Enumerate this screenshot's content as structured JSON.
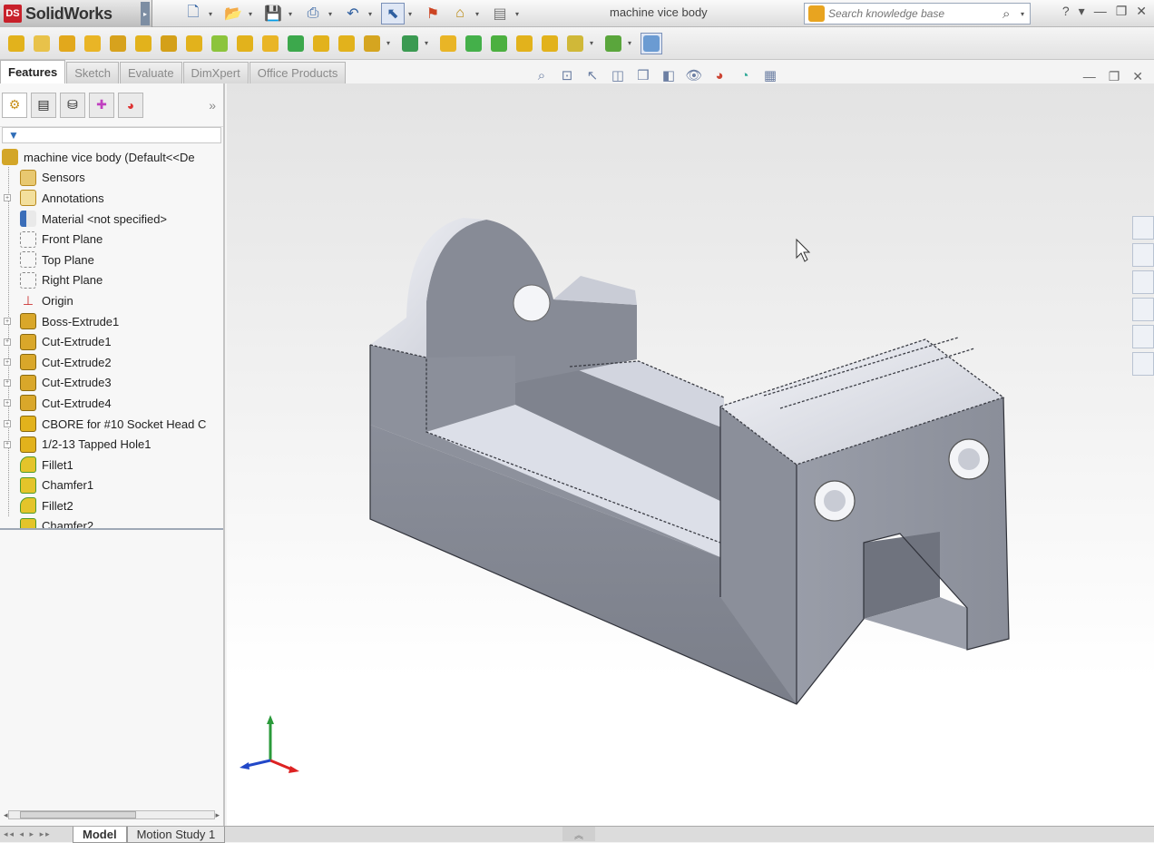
{
  "app": {
    "name": "SolidWorks",
    "logo_text": "DS"
  },
  "document_title": "machine vice body",
  "search": {
    "placeholder": "Search knowledge base"
  },
  "window_controls": [
    "?",
    "▾",
    "—",
    "❐",
    "✕"
  ],
  "command_tabs": [
    {
      "label": "Features",
      "active": true
    },
    {
      "label": "Sketch",
      "active": false
    },
    {
      "label": "Evaluate",
      "active": false
    },
    {
      "label": "DimXpert",
      "active": false
    },
    {
      "label": "Office Products",
      "active": false
    }
  ],
  "feature_tree": {
    "root": "machine vice body  (Default<<De",
    "items": [
      {
        "label": "Sensors",
        "icon": "sensor-icon"
      },
      {
        "label": "Annotations",
        "icon": "annotation-icon"
      },
      {
        "label": "Material <not specified>",
        "icon": "material-icon"
      },
      {
        "label": "Front Plane",
        "icon": "plane-icon"
      },
      {
        "label": "Top Plane",
        "icon": "plane-icon"
      },
      {
        "label": "Right Plane",
        "icon": "plane-icon"
      },
      {
        "label": "Origin",
        "icon": "origin-icon"
      },
      {
        "label": "Boss-Extrude1",
        "icon": "extrude-icon"
      },
      {
        "label": "Cut-Extrude1",
        "icon": "cut-icon"
      },
      {
        "label": "Cut-Extrude2",
        "icon": "cut-icon"
      },
      {
        "label": "Cut-Extrude3",
        "icon": "cut-icon"
      },
      {
        "label": "Cut-Extrude4",
        "icon": "cut-icon"
      },
      {
        "label": "CBORE for #10 Socket Head C",
        "icon": "hole-icon"
      },
      {
        "label": "1/2-13 Tapped Hole1",
        "icon": "hole-icon"
      },
      {
        "label": "Fillet1",
        "icon": "fillet-icon"
      },
      {
        "label": "Chamfer1",
        "icon": "chamfer-icon"
      },
      {
        "label": "Fillet2",
        "icon": "fillet-icon"
      },
      {
        "label": "Chamfer2",
        "icon": "chamfer-icon"
      }
    ]
  },
  "bottom_tabs": [
    {
      "label": "Model",
      "active": true
    },
    {
      "label": "Motion Study 1",
      "active": false
    }
  ],
  "colors": {
    "accent": "#2f5fa0",
    "feature_icon": "#e2b21c",
    "model_face": "#8a8e98"
  }
}
